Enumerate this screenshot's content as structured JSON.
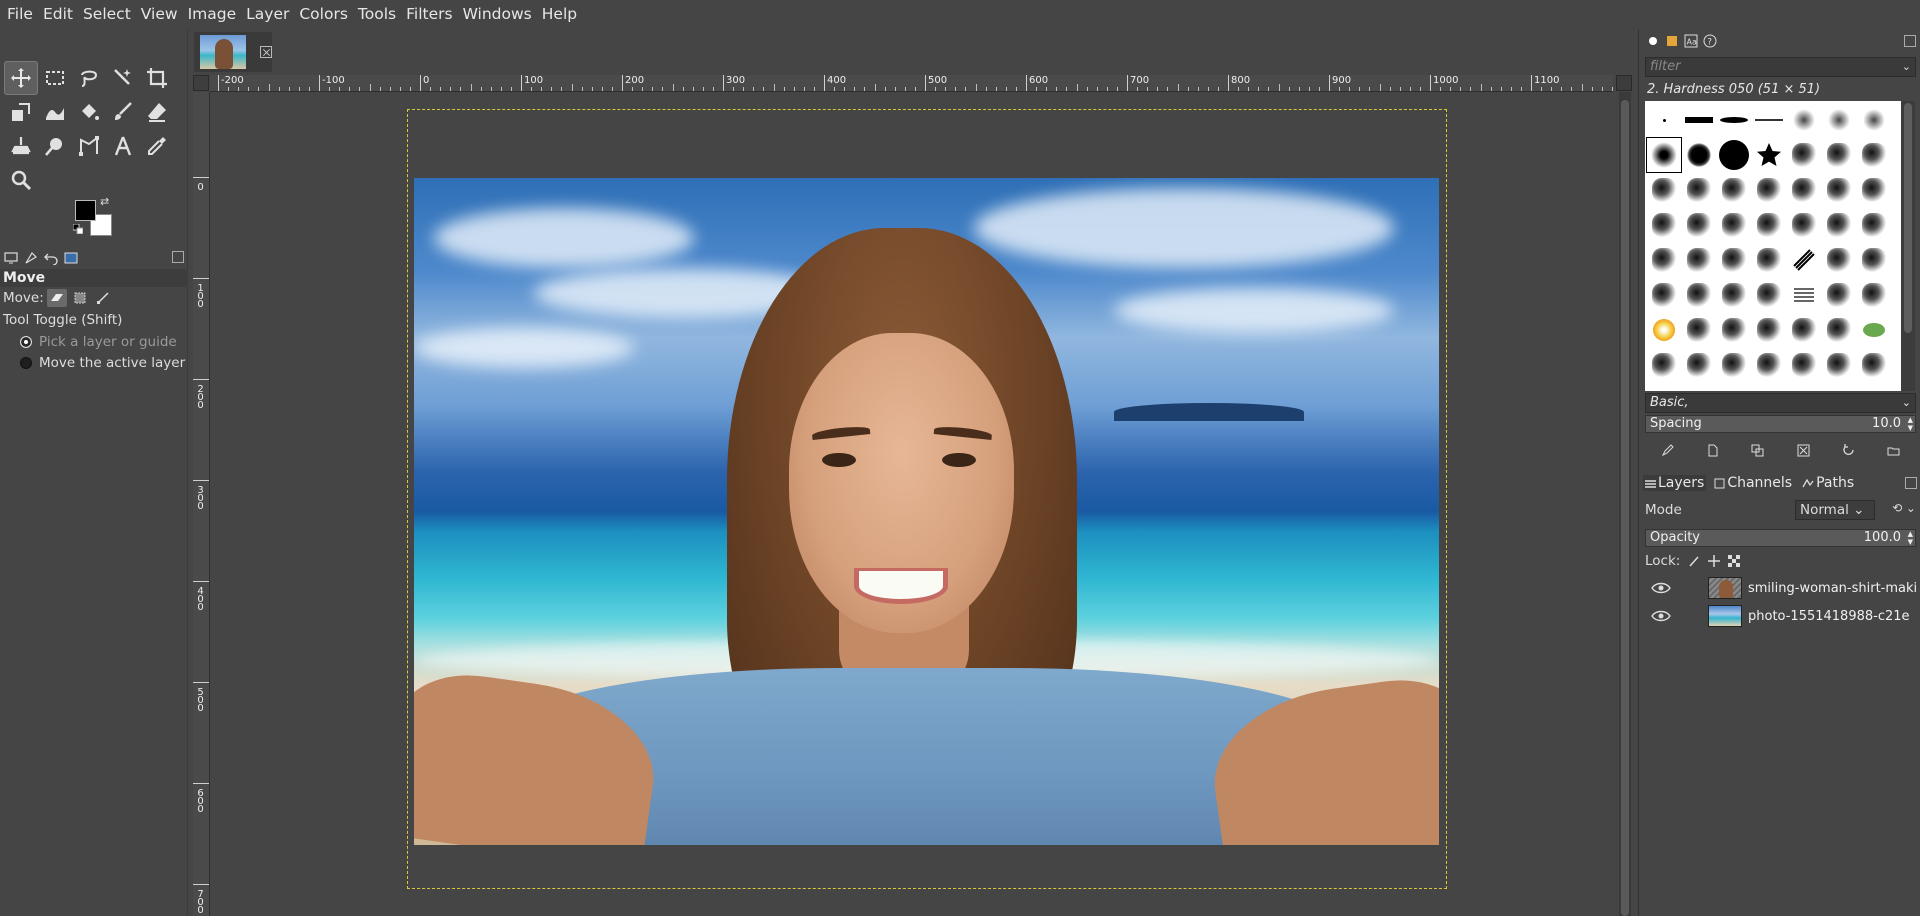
{
  "menubar": {
    "items": [
      "File",
      "Edit",
      "Select",
      "View",
      "Image",
      "Layer",
      "Colors",
      "Tools",
      "Filters",
      "Windows",
      "Help"
    ]
  },
  "toolbox": {
    "tools": [
      {
        "name": "move-tool-icon",
        "active": true
      },
      {
        "name": "rect-select-icon"
      },
      {
        "name": "free-select-icon"
      },
      {
        "name": "fuzzy-select-icon"
      },
      {
        "name": "crop-icon"
      },
      {
        "name": "unified-transform-icon"
      },
      {
        "name": "warp-transform-icon"
      },
      {
        "name": "bucket-fill-icon"
      },
      {
        "name": "paintbrush-icon"
      },
      {
        "name": "eraser-icon"
      },
      {
        "name": "clone-icon"
      },
      {
        "name": "smudge-icon"
      },
      {
        "name": "paths-icon"
      },
      {
        "name": "text-tool-icon"
      },
      {
        "name": "color-picker-icon"
      },
      {
        "name": "zoom-icon"
      }
    ],
    "fg_color": "#000000",
    "bg_color": "#ffffff"
  },
  "tool_options": {
    "title": "Move",
    "move_label": "Move:",
    "toggle_label": "Tool Toggle  (Shift)",
    "radio_pick": "Pick a layer or guide",
    "radio_active": "Move the active layer"
  },
  "image_window": {
    "tab_thumbnail": "beach selfie composite",
    "ruler_h_labels": [
      "-200",
      "-100",
      "0",
      "100",
      "200",
      "300",
      "400",
      "500",
      "600",
      "700",
      "800",
      "900",
      "1000",
      "1100"
    ],
    "ruler_v_labels": [
      "0",
      "1\n0\n0",
      "2\n0\n0",
      "3\n0\n0",
      "4\n0\n0",
      "5\n0\n0",
      "6\n0\n0",
      "7\n0\n0"
    ]
  },
  "brushes": {
    "filter_placeholder": "filter",
    "selected_brush": "2. Hardness 050 (51 × 51)",
    "preset": "Basic,",
    "spacing_label": "Spacing",
    "spacing_value": "10.0"
  },
  "layers_dock": {
    "tabs": [
      "Layers",
      "Channels",
      "Paths"
    ],
    "mode_label": "Mode",
    "mode_value": "Normal",
    "opacity_label": "Opacity",
    "opacity_value": "100.0",
    "lock_label": "Lock:",
    "layers": [
      {
        "name": "smiling-woman-shirt-maki",
        "visible": true
      },
      {
        "name": "photo-1551418988-c21e",
        "visible": true
      }
    ]
  }
}
